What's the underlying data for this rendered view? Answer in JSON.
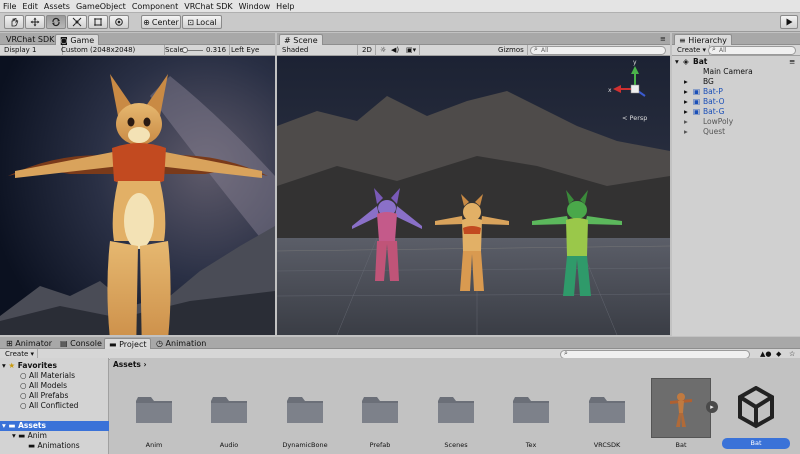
{
  "menubar": [
    "File",
    "Edit",
    "Assets",
    "GameObject",
    "Component",
    "VRChat SDK",
    "Window",
    "Help"
  ],
  "toolbar": {
    "pivot_label": "Center",
    "space_label": "Local"
  },
  "game_panel": {
    "tabs": [
      "VRChat SDK",
      "Game"
    ],
    "display": "Display 1",
    "resolution": "Custom (2048x2048)",
    "scale_label": "Scale",
    "scale_value": "0.316",
    "eye": "Left Eye"
  },
  "scene_panel": {
    "tab": "Scene",
    "shading": "Shaded",
    "mode_2d": "2D",
    "gizmos": "Gizmos",
    "persp": "< Persp"
  },
  "hierarchy": {
    "tab": "Hierarchy",
    "create": "Create",
    "search_placeholder": "All",
    "root": "Bat",
    "items": [
      {
        "label": "Main Camera",
        "style": "normal",
        "arrow": false
      },
      {
        "label": "BG",
        "style": "normal",
        "arrow": true
      },
      {
        "label": "Bat-P",
        "style": "blue",
        "arrow": true
      },
      {
        "label": "Bat-O",
        "style": "blue",
        "arrow": true
      },
      {
        "label": "Bat-G",
        "style": "blue",
        "arrow": true
      },
      {
        "label": "LowPoly",
        "style": "grey",
        "arrow": true
      },
      {
        "label": "Quest",
        "style": "grey",
        "arrow": true
      }
    ]
  },
  "bottom_tabs": [
    "Animator",
    "Console",
    "Project",
    "Animation"
  ],
  "project": {
    "create": "Create",
    "breadcrumb": "Assets",
    "favorites": {
      "label": "Favorites",
      "items": [
        "All Materials",
        "All Models",
        "All Prefabs",
        "All Conflicted"
      ]
    },
    "tree": {
      "label": "Assets",
      "items": [
        "Anim",
        "Animations"
      ]
    },
    "assets": [
      "Anim",
      "Audio",
      "DynamicBone",
      "Prefab",
      "Scenes",
      "Tex",
      "VRCSDK",
      "Bat",
      "Bat"
    ]
  },
  "colors": {
    "selection": "#3a72d8",
    "panel": "#c2c2c2"
  }
}
